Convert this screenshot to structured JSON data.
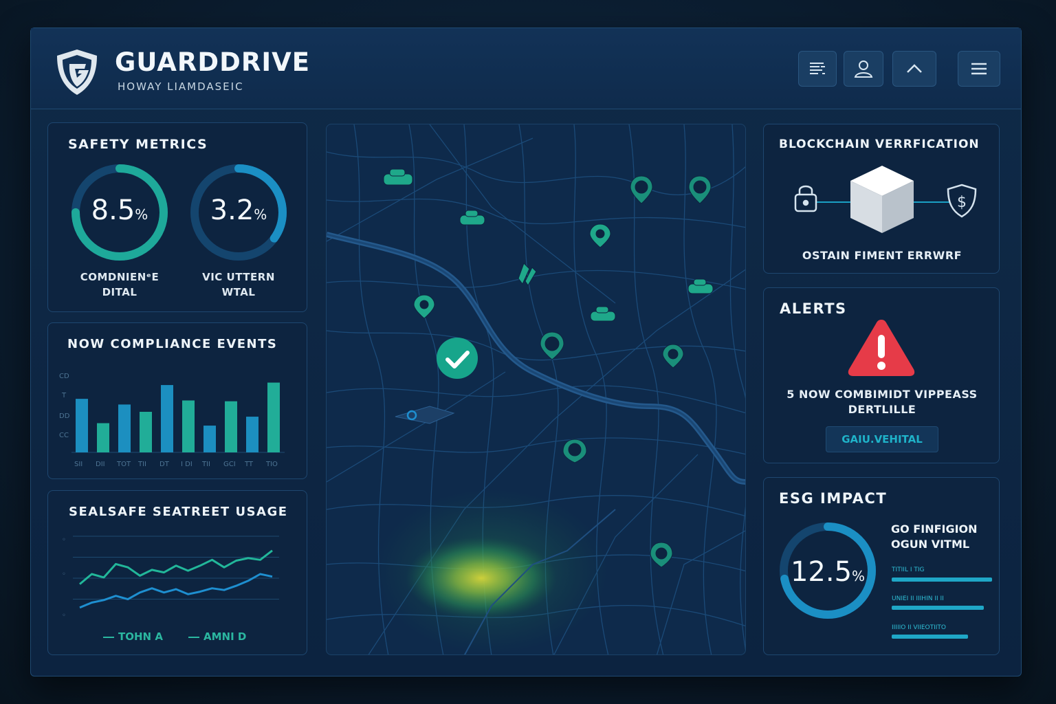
{
  "header": {
    "title": "GUARDDRIVE",
    "subtitle": "HOWAY LIAMDASEIC",
    "buttons": [
      {
        "icon": "report-icon"
      },
      {
        "icon": "user-icon"
      },
      {
        "icon": "chevron-up-icon"
      },
      {
        "icon": "menu-icon"
      }
    ]
  },
  "safety_metrics": {
    "title": "SAFETY METRICS",
    "gauges": [
      {
        "value": "8.5",
        "unit": "%",
        "label_line1": "COMDNIENᵉE",
        "label_line2": "DITAL",
        "fraction": 0.75,
        "color": "#1ea99a"
      },
      {
        "value": "3.2",
        "unit": "%",
        "label_line1": "VIC UTTERN",
        "label_line2": "WTAL",
        "fraction": 0.35,
        "color": "#1b8fc4"
      }
    ]
  },
  "compliance_events": {
    "title": "NOW COMPLIANCE EVENTS",
    "y_ticks": [
      "CD",
      "T",
      "DD",
      "CC"
    ],
    "x_ticks": [
      "SII",
      "DII",
      "TOT",
      "TII",
      "DT",
      "I DI",
      "TII",
      "GCI",
      "TT",
      "TIO"
    ],
    "chart_data": {
      "type": "bar",
      "categories": [
        "1",
        "2",
        "3",
        "4",
        "5",
        "6",
        "7",
        "8",
        "9",
        "10"
      ],
      "values": [
        66,
        36,
        59,
        50,
        83,
        64,
        33,
        63,
        44,
        86
      ],
      "ylim": [
        0,
        100
      ]
    }
  },
  "seatbelt_usage": {
    "title": "SEALSAFE SEATREET USAGE",
    "legend": [
      {
        "name": "TOHN A"
      },
      {
        "name": "AMNI D"
      }
    ],
    "chart_data": {
      "type": "line",
      "x": [
        1,
        2,
        3,
        4,
        5,
        6,
        7,
        8,
        9,
        10,
        11,
        12,
        13,
        14,
        15,
        16,
        17
      ],
      "series": [
        {
          "name": "TOHN A",
          "color": "#22b79a",
          "values": [
            38,
            50,
            46,
            62,
            58,
            48,
            55,
            52,
            60,
            54,
            60,
            67,
            58,
            66,
            69,
            67,
            78
          ]
        },
        {
          "name": "AMNI D",
          "color": "#1e8fd0",
          "values": [
            10,
            16,
            19,
            24,
            20,
            28,
            33,
            28,
            32,
            26,
            29,
            33,
            31,
            36,
            42,
            50,
            47
          ]
        }
      ],
      "ylim": [
        0,
        100
      ]
    }
  },
  "map": {
    "markers": [
      {
        "icon": "car-icon"
      },
      {
        "icon": "car-icon"
      },
      {
        "icon": "pin-icon"
      },
      {
        "icon": "pin-icon"
      },
      {
        "icon": "shield-pin-icon"
      },
      {
        "icon": "road-icon"
      },
      {
        "icon": "car-icon"
      },
      {
        "icon": "shield-pin-icon"
      },
      {
        "icon": "car-icon"
      },
      {
        "icon": "pin-icon"
      },
      {
        "icon": "pin-icon"
      },
      {
        "icon": "pin-icon"
      },
      {
        "icon": "pin-icon"
      }
    ],
    "check_icon": "check-circle-icon",
    "location_icon": "location-dot-icon"
  },
  "blockchain": {
    "title": "BLOCKCHAIN VERRFICATION",
    "caption": "OSTAIN FIMENT ERRWRF",
    "currency_symbol": "$"
  },
  "alerts": {
    "title": "ALERTS",
    "message_line1": "5 NOW COMBIMIDT VIPPEASS",
    "message_line2": "DERTLILLE",
    "button_label": "GAIU.VEHITAL"
  },
  "esg": {
    "title": "ESG IMPACT",
    "value": "12.5",
    "unit": "%",
    "fraction": 0.72,
    "label_line1": "GO FINFIGION",
    "label_line2": "OGUN VITML",
    "bars": [
      {
        "label": "TITIIL I TIG",
        "level": 1.0
      },
      {
        "label": "UNIEI II IIIHIN II II",
        "level": 0.92
      },
      {
        "label": "IIIIIO II VIIEOTIITO",
        "level": 0.76
      }
    ]
  }
}
